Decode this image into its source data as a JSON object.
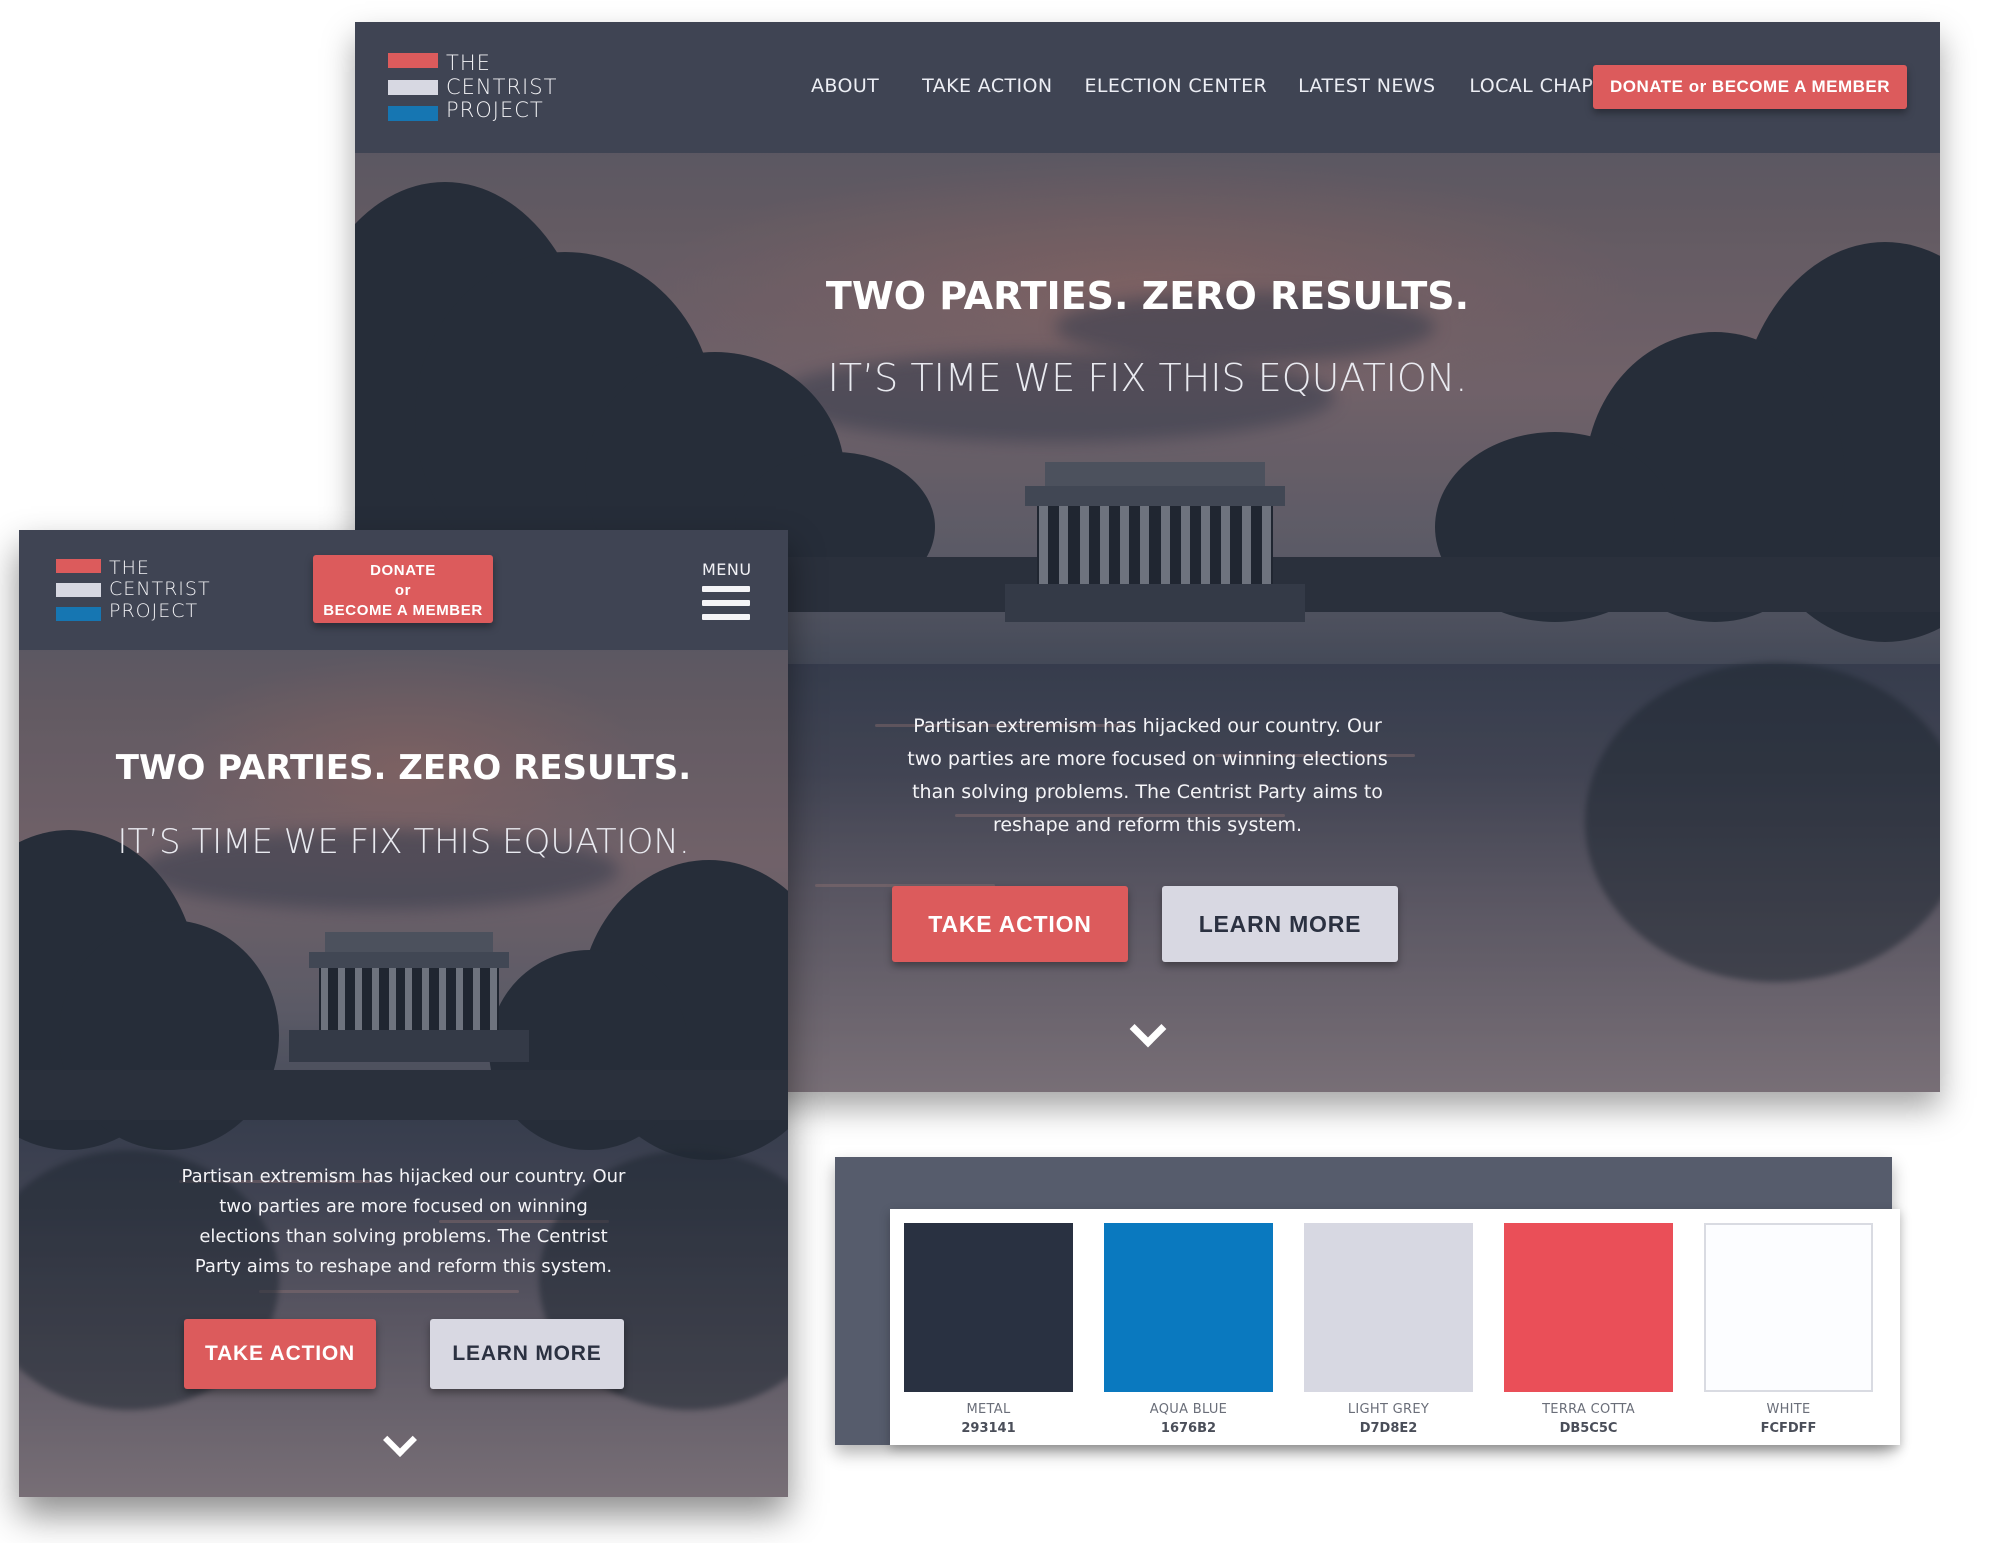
{
  "logo": {
    "lines": [
      "THE",
      "CENTRIST",
      "PROJECT"
    ],
    "stripe_colors": [
      "#dc5b5c",
      "#d7d8e2",
      "#1676b2"
    ]
  },
  "desktop": {
    "nav": {
      "items": [
        {
          "label": "ABOUT"
        },
        {
          "label": "TAKE ACTION"
        },
        {
          "label": "ELECTION CENTER"
        },
        {
          "label": "LATEST NEWS"
        },
        {
          "label": "LOCAL CHAPTERS"
        }
      ],
      "cta_label": "DONATE or BECOME A MEMBER"
    },
    "hero": {
      "headline": "TWO PARTIES. ZERO RESULTS.",
      "subheadline": "IT’S TIME WE FIX THIS EQUATION.",
      "paragraph_lines": [
        "Partisan extremism has hijacked our country. Our",
        "two parties are more focused on winning elections",
        "than solving problems. The Centrist Party aims to",
        "reshape and reform this system."
      ],
      "primary_button": "TAKE ACTION",
      "secondary_button": "LEARN MORE",
      "scroll_icon": "chevron-down-icon"
    }
  },
  "mobile": {
    "donate_lines": [
      "DONATE",
      "or",
      "BECOME A MEMBER"
    ],
    "menu_label": "MENU",
    "menu_icon": "hamburger-menu-icon",
    "hero": {
      "headline": "TWO PARTIES. ZERO RESULTS.",
      "subheadline": "IT’S TIME WE FIX THIS EQUATION.",
      "paragraph_lines": [
        "Partisan extremism has hijacked our country. Our",
        "two parties are more focused on winning",
        "elections than solving problems. The Centrist",
        "Party aims to reshape and reform this system."
      ],
      "primary_button": "TAKE ACTION",
      "secondary_button": "LEARN MORE",
      "scroll_icon": "chevron-down-icon"
    }
  },
  "palette": {
    "swatches": [
      {
        "name": "METAL",
        "hex": "293141",
        "color": "#293141"
      },
      {
        "name": "AQUA BLUE",
        "hex": "1676B2",
        "color": "#0a79bf"
      },
      {
        "name": "LIGHT GREY",
        "hex": "D7D8E2",
        "color": "#d7d8e2"
      },
      {
        "name": "TERRA COTTA",
        "hex": "DB5C5C",
        "color": "#ea4f58"
      },
      {
        "name": "WHITE",
        "hex": "FCFDFF",
        "color": "#fcfdff"
      }
    ]
  },
  "colors": {
    "nav_bg": "#3f4453",
    "accent_red": "#dc5b5c",
    "light_grey": "#d8d8e2",
    "palette_bg": "#565c6c"
  }
}
